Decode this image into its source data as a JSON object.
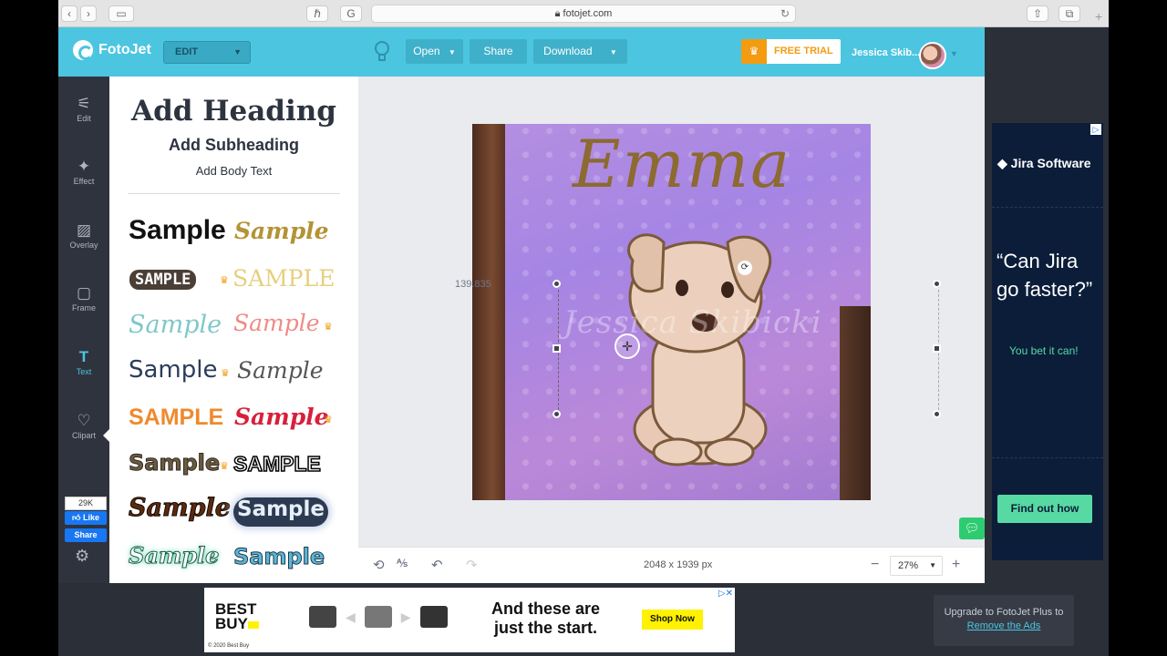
{
  "browser": {
    "url": "fotojet.com",
    "back": "‹",
    "forward": "›"
  },
  "topbar": {
    "logo": "FotoJet",
    "mode": "EDIT",
    "open_label": "Open",
    "share_label": "Share",
    "download_label": "Download",
    "free_trial_label": "FREE TRIAL",
    "user_name": "Jessica Skib..."
  },
  "rail": {
    "items": [
      {
        "label": "Edit",
        "icon": "sliders-icon"
      },
      {
        "label": "Effect",
        "icon": "wand-icon"
      },
      {
        "label": "Overlay",
        "icon": "overlay-icon"
      },
      {
        "label": "Frame",
        "icon": "frame-icon"
      },
      {
        "label": "Text",
        "icon": "text-icon"
      },
      {
        "label": "Clipart",
        "icon": "heart-icon"
      }
    ],
    "fb_count": "29K",
    "fb_like": "Like",
    "fb_share": "Share"
  },
  "panel": {
    "heading": "Add Heading",
    "subheading": "Add Subheading",
    "body": "Add Body Text",
    "samples": [
      "Sample",
      "Sample",
      "SAMPLE",
      "SAMPLE",
      "Sample",
      "Sample",
      "Sample",
      "Sample",
      "SAMPLE",
      "Sample",
      "Sample",
      "SAMPLE",
      "Sample",
      "Sample",
      "Sample",
      "Sample"
    ]
  },
  "canvas": {
    "photo_text": "Emma",
    "watermark": "Jessica Skibicki",
    "coord_readout": "139.835"
  },
  "bottom": {
    "dimensions": "2048 x 1939 px",
    "zoom": "27%"
  },
  "right_ad": {
    "brand": "Jira Software",
    "headline": "“Can Jira go faster?”",
    "sub": "You bet it can!",
    "cta": "Find out how"
  },
  "banner_ad": {
    "brand_line1": "BEST",
    "brand_line2": "BUY",
    "headline_line1": "And these are",
    "headline_line2": "just the start.",
    "cta": "Shop Now",
    "copyright": "© 2020 Best Buy"
  },
  "upsell": {
    "line1": "Upgrade to FotoJet Plus to",
    "link": "Remove the Ads"
  }
}
